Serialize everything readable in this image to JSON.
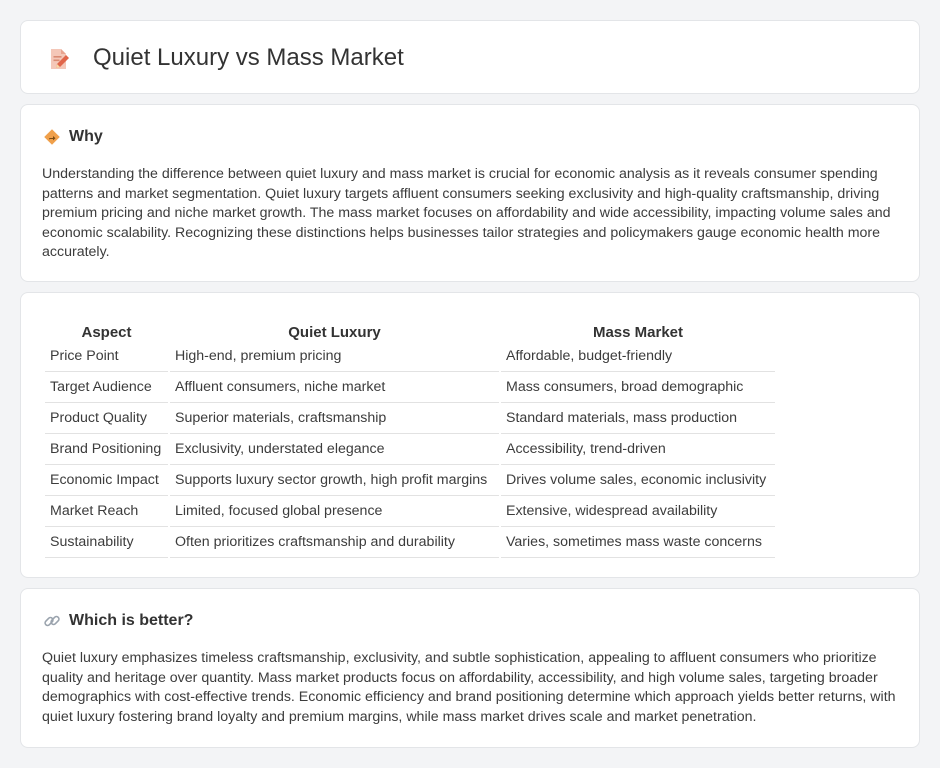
{
  "header": {
    "title": "Quiet Luxury vs Mass Market",
    "icon": "document-pencil-icon"
  },
  "why": {
    "title": "Why",
    "icon": "diamond-sign-icon",
    "text": "Understanding the difference between quiet luxury and mass market is crucial for economic analysis as it reveals consumer spending patterns and market segmentation. Quiet luxury targets affluent consumers seeking exclusivity and high-quality craftsmanship, driving premium pricing and niche market growth. The mass market focuses on affordability and wide accessibility, impacting volume sales and economic scalability. Recognizing these distinctions helps businesses tailor strategies and policymakers gauge economic health more accurately."
  },
  "table": {
    "headers": [
      "Aspect",
      "Quiet Luxury",
      "Mass Market"
    ],
    "rows": [
      [
        "Price Point",
        "High-end, premium pricing",
        "Affordable, budget-friendly"
      ],
      [
        "Target Audience",
        "Affluent consumers, niche market",
        "Mass consumers, broad demographic"
      ],
      [
        "Product Quality",
        "Superior materials, craftsmanship",
        "Standard materials, mass production"
      ],
      [
        "Brand Positioning",
        "Exclusivity, understated elegance",
        "Accessibility, trend-driven"
      ],
      [
        "Economic Impact",
        "Supports luxury sector growth, high profit margins",
        "Drives volume sales, economic inclusivity"
      ],
      [
        "Market Reach",
        "Limited, focused global presence",
        "Extensive, widespread availability"
      ],
      [
        "Sustainability",
        "Often prioritizes craftsmanship and durability",
        "Varies, sometimes mass waste concerns"
      ]
    ]
  },
  "better": {
    "title": "Which is better?",
    "icon": "link-icon",
    "text": "Quiet luxury emphasizes timeless craftsmanship, exclusivity, and subtle sophistication, appealing to affluent consumers who prioritize quality and heritage over quantity. Mass market products focus on affordability, accessibility, and high volume sales, targeting broader demographics with cost-effective trends. Economic efficiency and brand positioning determine which approach yields better returns, with quiet luxury fostering brand loyalty and premium margins, while mass market drives scale and market penetration."
  },
  "colors": {
    "background": "#f3f4f6",
    "card": "#ffffff",
    "icon_orange": "#f0a04b",
    "icon_doc": "#e07a5f"
  }
}
